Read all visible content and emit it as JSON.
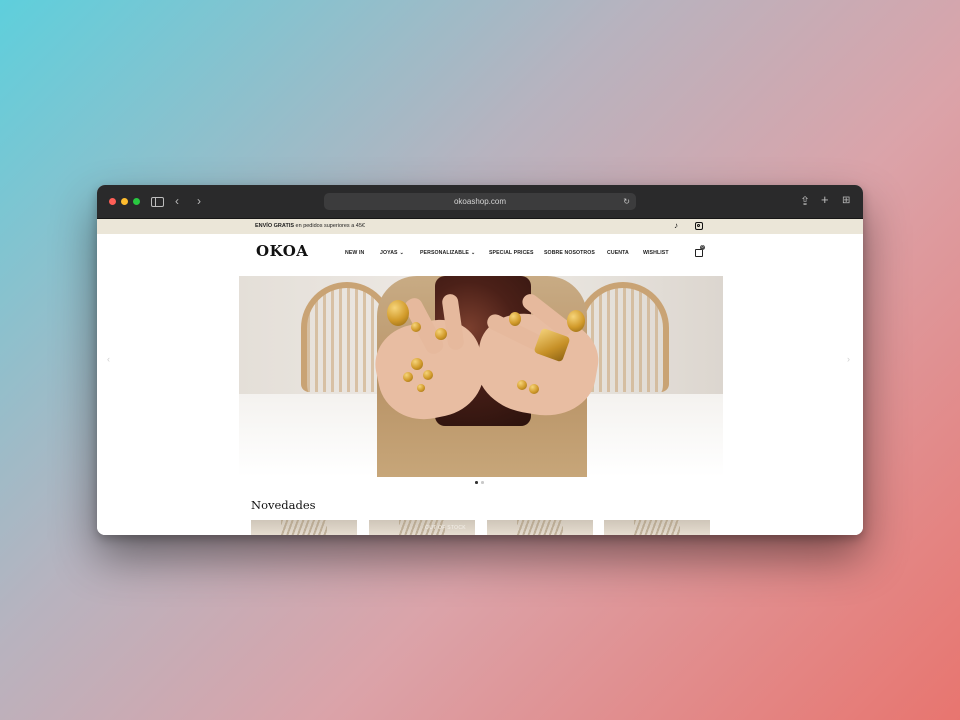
{
  "browser": {
    "url": "okoashop.com"
  },
  "announcement": {
    "bold": "ENVÍO GRATIS",
    "rest": " en pedidos superiores a 45€"
  },
  "social": {
    "icons": [
      "tiktok-icon",
      "instagram-icon"
    ]
  },
  "header": {
    "logo": "OKOA",
    "nav": [
      {
        "label": "NEW IN",
        "dropdown": false
      },
      {
        "label": "JOYAS",
        "dropdown": true
      },
      {
        "label": "PERSONALIZABLE",
        "dropdown": true
      },
      {
        "label": "SPECIAL PRICES",
        "dropdown": false
      },
      {
        "label": "SOBRE NOSOTROS",
        "dropdown": false
      },
      {
        "label": "CUENTA",
        "dropdown": false
      },
      {
        "label": "WISHLIST",
        "dropdown": false
      }
    ],
    "cart_count": "0"
  },
  "hero": {
    "slides": 2,
    "active_slide": 1
  },
  "section": {
    "title": "Novedades",
    "product_overlay_label": "OUT OF STOCK"
  },
  "colors": {
    "announcement_bg": "#ebe6d8",
    "chrome_bg": "#2a2a2b",
    "gold": "#d19a2a"
  }
}
